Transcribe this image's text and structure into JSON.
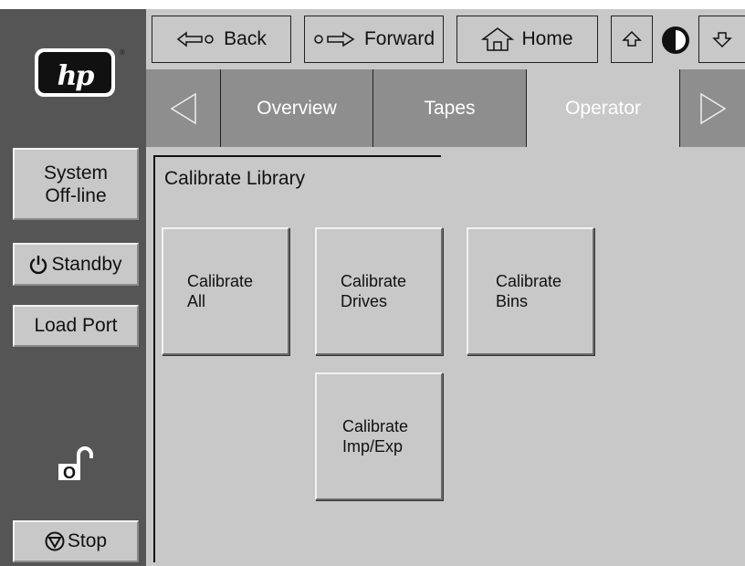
{
  "brand": {
    "logo_text": "hp",
    "logo_mark": "®"
  },
  "toolbar": {
    "back_label": "Back",
    "forward_label": "Forward",
    "home_label": "Home"
  },
  "tabs": [
    {
      "label": "Overview",
      "selected": false
    },
    {
      "label": "Tapes",
      "selected": false
    },
    {
      "label": "Operator",
      "selected": true
    }
  ],
  "side": {
    "system_line1": "System",
    "system_line2": "Off-line",
    "standby_label": "Standby",
    "loadport_label": "Load Port",
    "lock_label": "O",
    "stop_label": "Stop"
  },
  "main": {
    "title": "Calibrate Library",
    "buttons": [
      {
        "line1": "Calibrate",
        "line2": "All"
      },
      {
        "line1": "Calibrate",
        "line2": "Drives"
      },
      {
        "line1": "Calibrate",
        "line2": "Bins"
      },
      {
        "line1": "Calibrate",
        "line2": "Imp/Exp"
      }
    ]
  },
  "colors": {
    "panel_dark": "#555555",
    "button_gray": "#c8c8c8",
    "tab_inactive": "#8e8e8e"
  }
}
